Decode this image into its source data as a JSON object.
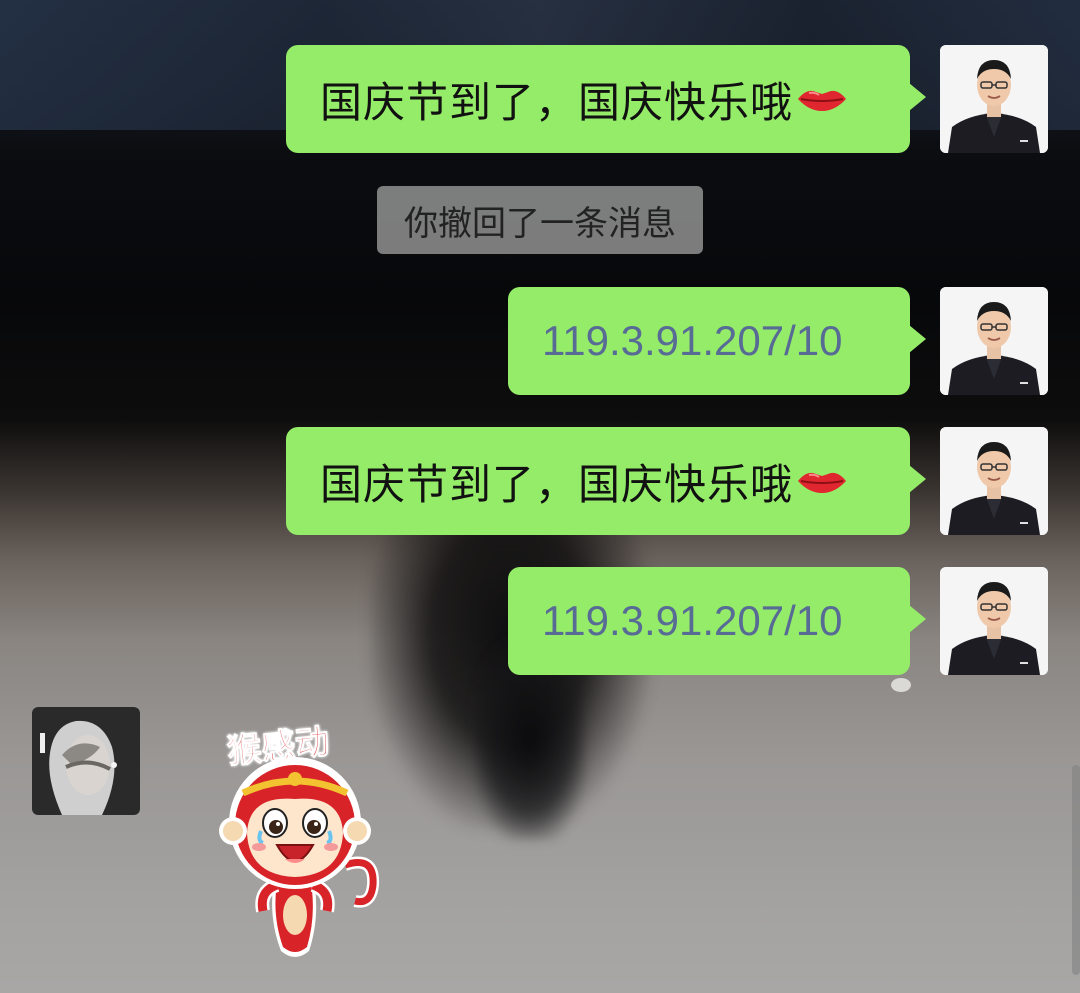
{
  "chat": {
    "messages": [
      {
        "type": "text",
        "sender": "me",
        "text": "国庆节到了，国庆快乐哦",
        "emoji": "lips-icon"
      },
      {
        "type": "system",
        "text": "你撤回了一条消息"
      },
      {
        "type": "link",
        "sender": "me",
        "text": "119.3.91.207/10"
      },
      {
        "type": "text",
        "sender": "me",
        "text": "国庆节到了，国庆快乐哦",
        "emoji": "lips-icon"
      },
      {
        "type": "link",
        "sender": "me",
        "text": "119.3.91.207/10"
      },
      {
        "type": "sticker",
        "sender": "contact",
        "caption": "猴感动",
        "icon": "monkey-sticker"
      }
    ]
  },
  "colors": {
    "sent_bubble": "#95ec69",
    "link_text": "#576b95",
    "recall_bg": "#969696",
    "sticker_red": "#d62a2a"
  }
}
